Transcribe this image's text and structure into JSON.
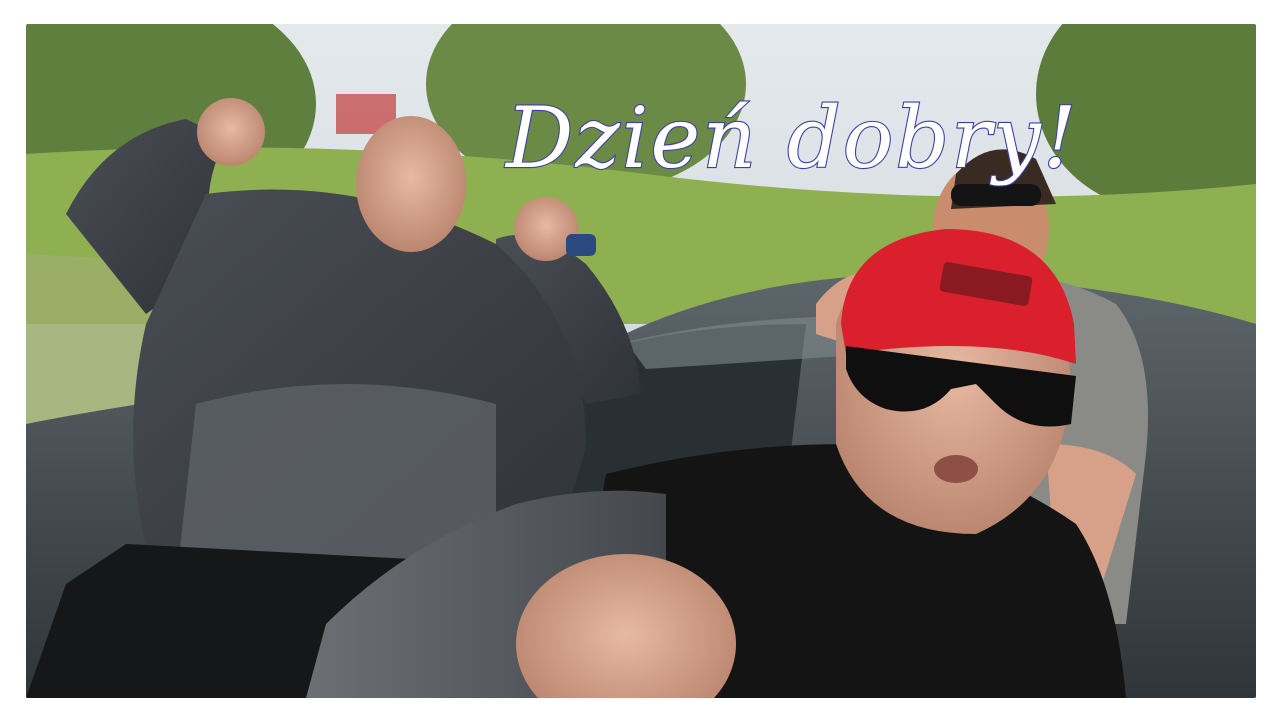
{
  "overlay": {
    "caption": "Dzień dobry!"
  },
  "scene": {
    "description_colors": {
      "cap": "#e0212e",
      "jacket": "#3d4046",
      "shirt": "#141414",
      "foliage": "#7fa34e"
    }
  }
}
